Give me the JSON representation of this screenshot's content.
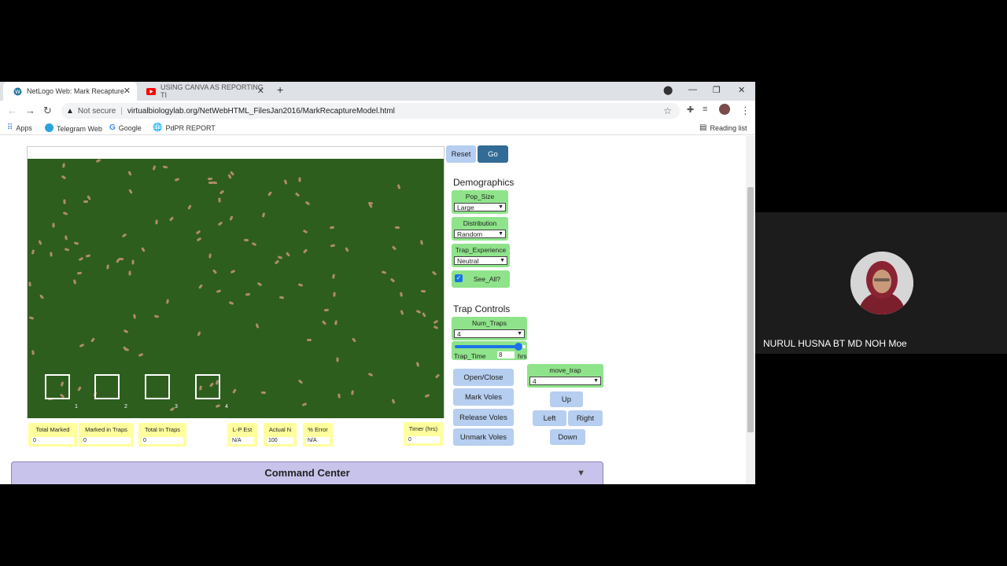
{
  "tabs": [
    {
      "label": "NetLogo Web: Mark Recapture",
      "active": true
    },
    {
      "label": "USING CANVA AS REPORTING TI",
      "active": false
    }
  ],
  "toolbar": {
    "not_secure": "Not secure",
    "url": "virtualbiologylab.org/NetWebHTML_FilesJan2016/MarkRecaptureModel.html"
  },
  "bookmarks": {
    "apps": "Apps",
    "items": [
      "Telegram Web",
      "Google",
      "PdPR REPORT"
    ],
    "reading_list": "Reading list"
  },
  "model": {
    "reset": "Reset",
    "go": "Go",
    "demographics": "Demographics",
    "pop_size": {
      "label": "Pop_Size",
      "value": "Large"
    },
    "distribution": {
      "label": "Distribution",
      "value": "Random"
    },
    "trap_experience": {
      "label": "Trap_Experience",
      "value": "Neutral"
    },
    "see_all": {
      "label": "See_All?",
      "checked": true
    },
    "trap_controls": "Trap Controls",
    "num_traps": {
      "label": "Num_Traps",
      "value": "4"
    },
    "trap_time": {
      "label": "Trap_Time",
      "value": "8",
      "unit": "hrs",
      "fraction": 0.9
    },
    "move_trap": {
      "label": "move_trap",
      "value": "4"
    },
    "buttons": {
      "open_close": "Open/Close",
      "mark_voles": "Mark Voles",
      "release_voles": "Release Voles",
      "unmark_voles": "Unmark Voles",
      "up": "Up",
      "left": "Left",
      "right": "Right",
      "down": "Down"
    },
    "trap_numbers": [
      "1",
      "2",
      "3",
      "4"
    ],
    "monitors": {
      "total_marked": {
        "label": "Total Marked",
        "value": "0"
      },
      "marked_in_traps": {
        "label": "Marked in Traps",
        "value": "0"
      },
      "total_in_traps": {
        "label": "Total In Traps",
        "value": "0"
      },
      "lp_est": {
        "label": "L-P Est",
        "value": "N/A"
      },
      "actual_n": {
        "label": "Actual N",
        "value": "100"
      },
      "pct_error": {
        "label": "% Error",
        "value": "N/A"
      },
      "timer": {
        "label": "Timer (hrs)",
        "value": "0"
      }
    },
    "command_center": "Command Center"
  },
  "presenter": {
    "name": "NURUL HUSNA BT MD NOH Moe"
  },
  "colors": {
    "world": "#2d5e1e",
    "button": "#b6cef0",
    "go": "#326b96",
    "chooser": "#8fe38a",
    "monitor": "#ffff9e"
  }
}
